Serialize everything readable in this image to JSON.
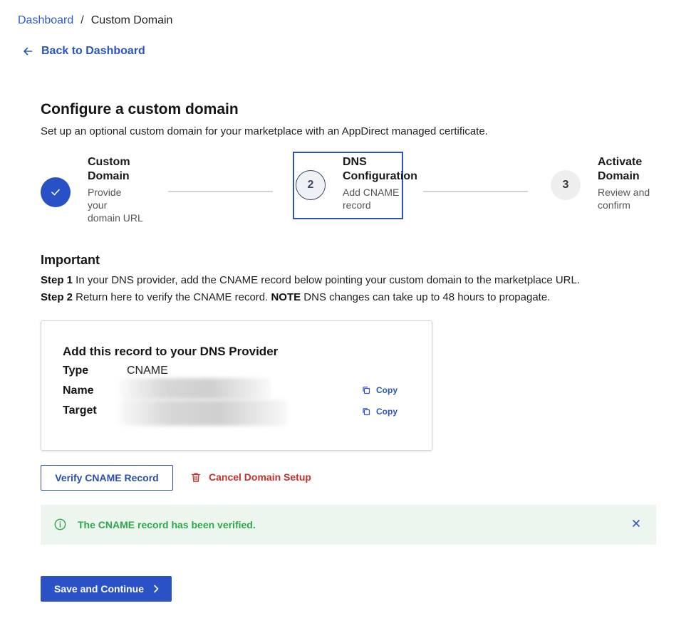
{
  "breadcrumb": {
    "parent": "Dashboard",
    "separator": "/",
    "current": "Custom Domain"
  },
  "back_link": {
    "label": "Back to Dashboard",
    "icon": "arrow-left-icon"
  },
  "header": {
    "title": "Configure a custom domain",
    "subtitle": "Set up an optional custom domain for your marketplace with an AppDirect managed certificate."
  },
  "stepper": {
    "steps": [
      {
        "number": "",
        "title_line1": "Custom",
        "title_line2": "Domain",
        "desc_line1": "Provide",
        "desc_line2": "your",
        "desc_line3": "domain URL",
        "status": "complete",
        "icon": "check-icon"
      },
      {
        "number": "2",
        "title_line1": "DNS",
        "title_line2": "Configuration",
        "desc_line1": "Add CNAME",
        "desc_line2": "record",
        "desc_line3": "",
        "status": "active"
      },
      {
        "number": "3",
        "title_line1": "Activate",
        "title_line2": "Domain",
        "desc_line1": "Review and",
        "desc_line2": "confirm",
        "desc_line3": "",
        "status": "upcoming"
      }
    ]
  },
  "important": {
    "title": "Important",
    "step1_label": "Step 1",
    "step1_text": " In your DNS provider, add the CNAME record below pointing your custom domain to the marketplace URL.",
    "step2_label": "Step 2",
    "step2_text": " Return here to verify the CNAME record. ",
    "note_label": "NOTE",
    "note_text": " DNS changes can take up to 48 hours to propagate."
  },
  "record_card": {
    "title": "Add this record to your DNS Provider",
    "type_label": "Type",
    "type_value": "CNAME",
    "name_label": "Name",
    "target_label": "Target",
    "copy_label": "Copy"
  },
  "actions": {
    "verify_label": "Verify CNAME Record",
    "cancel_label": "Cancel Domain Setup"
  },
  "alert": {
    "message": "The CNAME record has been verified.",
    "icon": "info-circle-icon"
  },
  "footer": {
    "save_label": "Save and Continue"
  },
  "colors": {
    "primary": "#2a51c6",
    "link": "#2a5bc8",
    "danger": "#c4302b",
    "success_text": "#2fa84a",
    "success_bg": "#ecf6ef"
  }
}
